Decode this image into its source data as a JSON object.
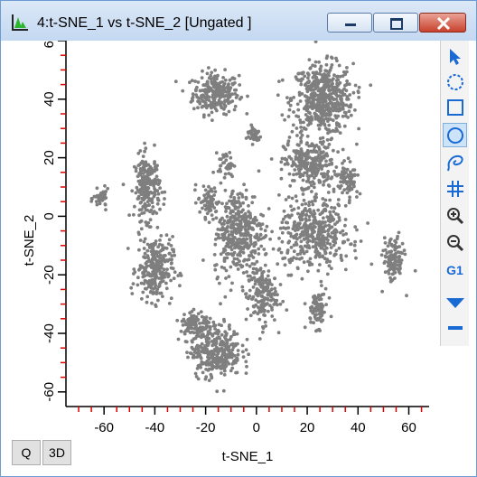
{
  "window": {
    "title": "4:t-SNE_1 vs t-SNE_2 [Ungated ]"
  },
  "toolbar": {
    "tools": [
      {
        "icon": "pointer-arrow-icon"
      },
      {
        "icon": "dashed-circle-icon"
      },
      {
        "icon": "rectangle-gate-icon"
      },
      {
        "icon": "ellipse-gate-icon"
      },
      {
        "icon": "freehand-gate-icon"
      },
      {
        "icon": "grid-quadrant-icon"
      },
      {
        "icon": "zoom-in-icon"
      },
      {
        "icon": "zoom-out-icon"
      },
      {
        "icon": "gate-label-icon",
        "label": "G1"
      },
      {
        "icon": "triangle-down-icon"
      },
      {
        "icon": "minus-icon"
      }
    ],
    "accent_color": "#1a6ad4",
    "active_tool": "ellipse-gate-icon"
  },
  "buttons": {
    "q_label": "Q",
    "threed_label": "3D"
  },
  "chart_data": {
    "type": "scatter",
    "xlabel": "t-SNE_1",
    "ylabel": "t-SNE_2",
    "xlim": [
      -75,
      68
    ],
    "ylim": [
      -65,
      60
    ],
    "x_ticks": [
      -60,
      -40,
      -20,
      0,
      20,
      40,
      60
    ],
    "y_ticks": [
      -60,
      -40,
      -20,
      0,
      20,
      40,
      60
    ],
    "point_color": "#7f7f7f",
    "axis_tick_color": "#e00000",
    "clusters": [
      {
        "cx": -16,
        "cy": 42,
        "rx": 9,
        "ry": 7,
        "n": 260
      },
      {
        "cx": 26,
        "cy": 40,
        "rx": 12,
        "ry": 12,
        "n": 520
      },
      {
        "cx": 21,
        "cy": 18,
        "rx": 10,
        "ry": 8,
        "n": 260
      },
      {
        "cx": -43,
        "cy": 10,
        "rx": 5,
        "ry": 11,
        "n": 220
      },
      {
        "cx": -61,
        "cy": 6,
        "rx": 3,
        "ry": 3,
        "n": 40
      },
      {
        "cx": -40,
        "cy": -18,
        "rx": 7,
        "ry": 11,
        "n": 260
      },
      {
        "cx": -19,
        "cy": 5,
        "rx": 4,
        "ry": 5,
        "n": 60
      },
      {
        "cx": -12,
        "cy": 18,
        "rx": 3,
        "ry": 4,
        "n": 40
      },
      {
        "cx": -7,
        "cy": -5,
        "rx": 10,
        "ry": 15,
        "n": 380
      },
      {
        "cx": 2,
        "cy": -27,
        "rx": 6,
        "ry": 10,
        "n": 170
      },
      {
        "cx": -1,
        "cy": 28,
        "rx": 3,
        "ry": 3,
        "n": 40
      },
      {
        "cx": -16,
        "cy": -46,
        "rx": 10,
        "ry": 9,
        "n": 330
      },
      {
        "cx": -24,
        "cy": -37,
        "rx": 6,
        "ry": 5,
        "n": 100
      },
      {
        "cx": 23,
        "cy": -6,
        "rx": 14,
        "ry": 12,
        "n": 430
      },
      {
        "cx": 24,
        "cy": -32,
        "rx": 4,
        "ry": 6,
        "n": 80
      },
      {
        "cx": 54,
        "cy": -15,
        "rx": 4,
        "ry": 8,
        "n": 120
      },
      {
        "cx": 36,
        "cy": 12,
        "rx": 4,
        "ry": 6,
        "n": 80
      }
    ]
  }
}
